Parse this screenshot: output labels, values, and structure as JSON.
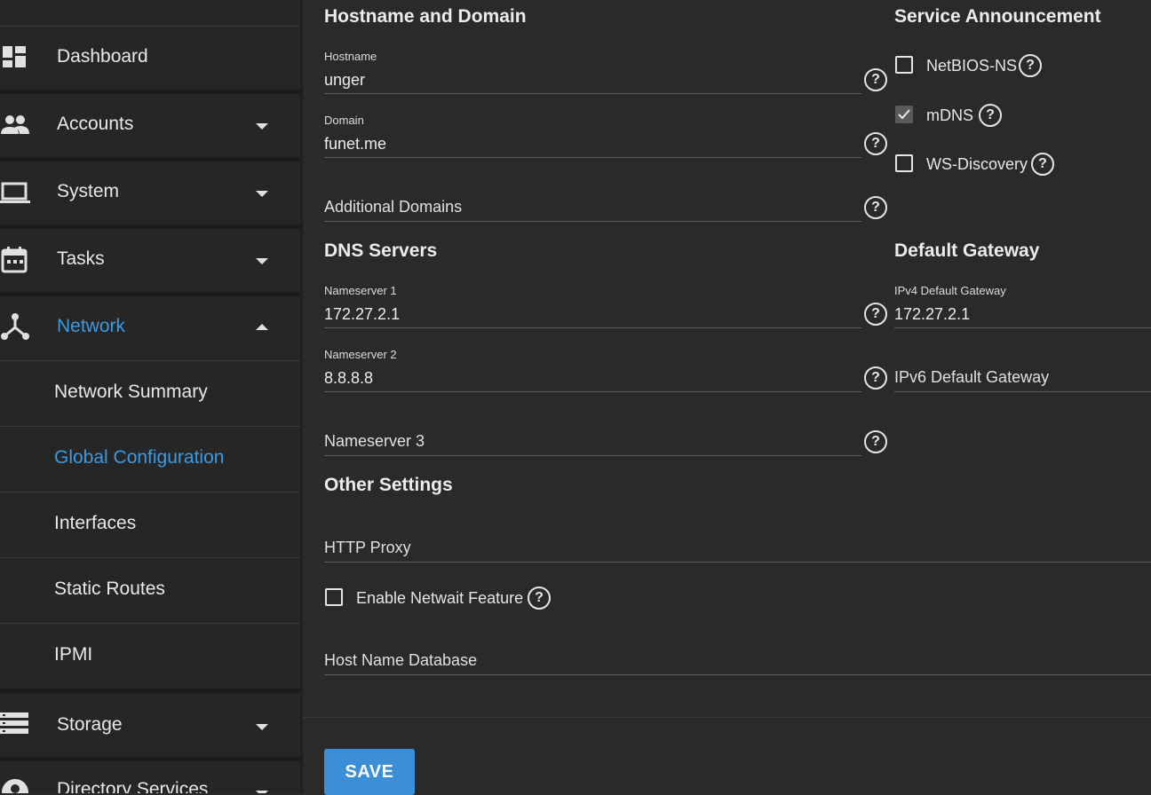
{
  "sidebar": {
    "items": [
      {
        "label": "Dashboard",
        "icon": "dashboard-icon"
      },
      {
        "label": "Accounts",
        "icon": "people-icon"
      },
      {
        "label": "System",
        "icon": "laptop-icon"
      },
      {
        "label": "Tasks",
        "icon": "calendar-icon"
      },
      {
        "label": "Network",
        "icon": "network-icon"
      },
      {
        "label": "Storage",
        "icon": "storage-icon"
      },
      {
        "label": "Directory Services",
        "icon": "user-circle-icon"
      }
    ],
    "network_sub": [
      {
        "label": "Network Summary"
      },
      {
        "label": "Global Configuration"
      },
      {
        "label": "Interfaces"
      },
      {
        "label": "Static Routes"
      },
      {
        "label": "IPMI"
      }
    ]
  },
  "hostname_section": {
    "title": "Hostname and Domain",
    "hostname_label": "Hostname",
    "hostname_value": "unger",
    "domain_label": "Domain",
    "domain_value": "funet.me",
    "additional_domains_placeholder": "Additional Domains"
  },
  "service_section": {
    "title": "Service Announcement",
    "netbios": {
      "label": "NetBIOS-NS",
      "checked": false
    },
    "mdns": {
      "label": "mDNS",
      "checked": true
    },
    "wsd": {
      "label": "WS-Discovery",
      "checked": false
    }
  },
  "dns_section": {
    "title": "DNS Servers",
    "ns1_label": "Nameserver 1",
    "ns1_value": "172.27.2.1",
    "ns2_label": "Nameserver 2",
    "ns2_value": "8.8.8.8",
    "ns3_placeholder": "Nameserver 3"
  },
  "gateway_section": {
    "title": "Default Gateway",
    "ipv4_label": "IPv4 Default Gateway",
    "ipv4_value": "172.27.2.1",
    "ipv6_placeholder": "IPv6 Default Gateway"
  },
  "other_section": {
    "title": "Other Settings",
    "http_proxy_placeholder": "HTTP Proxy",
    "netwait": {
      "label": "Enable Netwait Feature",
      "checked": false
    },
    "host_db_placeholder": "Host Name Database"
  },
  "actions": {
    "save_label": "SAVE"
  },
  "colors": {
    "accent": "#3b9ae1",
    "button": "#3b8fd6",
    "background": "#2a2a2a",
    "sidebar": "#262626"
  }
}
